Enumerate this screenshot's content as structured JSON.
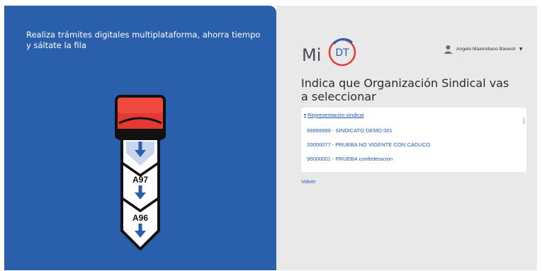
{
  "left_panel": {
    "tagline": "Realiza trámites digitales multiplataforma, ahorra tiempo y sáltate la fila",
    "tickets": [
      "A97",
      "A96"
    ],
    "background_color": "#2a5fac"
  },
  "brand": {
    "mi": "Mi",
    "dt": "DT"
  },
  "user": {
    "name": "Angelo Maximiliano Bavestr",
    "icon": "user-icon",
    "menu_icon": "caret-down-icon"
  },
  "heading": "Indica que Organización Sindical vas a seleccionar",
  "card": {
    "header": "Representación sindical",
    "items": [
      "99999999 - SINDICATO DEMO 001",
      "20000077 - PRUEBA NO VIGENTE CON CADUCO",
      "90000001 - PRUEBA confederacion"
    ]
  },
  "back_label": "Volver",
  "colors": {
    "link": "#1f57b0",
    "right_bg": "#e9e9ea",
    "brand_red": "#e23a32"
  }
}
